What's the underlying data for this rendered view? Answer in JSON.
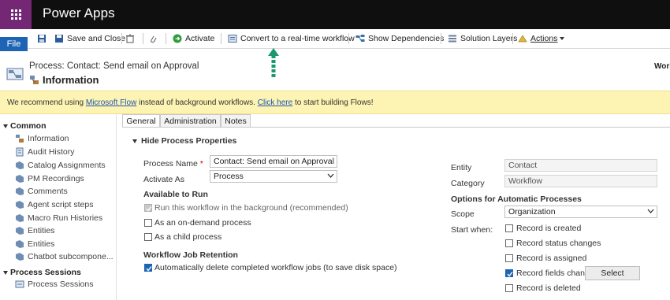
{
  "app": {
    "title": "Power Apps"
  },
  "ribbon": {
    "file": "File",
    "save_close": "Save and Close",
    "activate": "Activate",
    "convert": "Convert to a real-time workflow",
    "show_deps": "Show Dependencies",
    "solution_layers": "Solution Layers",
    "actions": "Actions"
  },
  "header": {
    "process": "Process: Contact: Send email on Approval",
    "title": "Information",
    "right_cut": "Work"
  },
  "banner": {
    "before": "We recommend using ",
    "link1": "Microsoft Flow",
    "middle": " instead of background workflows. ",
    "link2": "Click here",
    "after": " to start building Flows!"
  },
  "nav": {
    "group_common": "Common",
    "items": [
      "Information",
      "Audit History",
      "Catalog Assignments",
      "PM Recordings",
      "Comments",
      "Agent script steps",
      "Macro Run Histories",
      "Entities",
      "Entities",
      "Chatbot subcompone..."
    ],
    "group_sessions": "Process Sessions",
    "session_items": [
      "Process Sessions"
    ]
  },
  "tabs": [
    "General",
    "Administration",
    "Notes"
  ],
  "form": {
    "section": "Hide Process Properties",
    "process_name_label": "Process Name",
    "process_name_value": "Contact: Send email on Approval",
    "activate_as_label": "Activate As",
    "activate_as_value": "Process",
    "available_heading": "Available to Run",
    "run_background": "Run this workflow in the background (recommended)",
    "on_demand": "As an on-demand process",
    "child_process": "As a child process",
    "retention_heading": "Workflow Job Retention",
    "auto_delete": "Automatically delete completed workflow jobs (to save disk space)",
    "entity_label": "Entity",
    "entity_value": "Contact",
    "category_label": "Category",
    "category_value": "Workflow",
    "options_heading": "Options for Automatic Processes",
    "scope_label": "Scope",
    "scope_value": "Organization",
    "start_when_label": "Start when:",
    "record_created": "Record is created",
    "status_changes": "Record status changes",
    "assigned": "Record is assigned",
    "fields_change": "Record fields change",
    "deleted": "Record is deleted",
    "select_button": "Select"
  },
  "colors": {
    "accent": "#742774",
    "file": "#1e64b4",
    "banner": "#fdf4b3",
    "arrow": "#1a9a6c"
  }
}
